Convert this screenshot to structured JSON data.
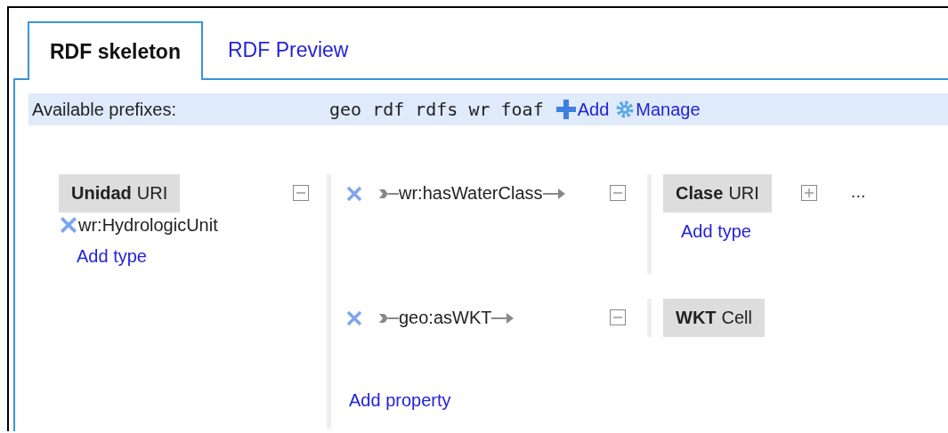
{
  "tabs": [
    {
      "label": "RDF skeleton",
      "selected": true
    },
    {
      "label": "RDF Preview",
      "selected": false
    }
  ],
  "prefix_bar": {
    "label": "Available prefixes:",
    "prefixes": [
      "geo",
      "rdf",
      "rdfs",
      "wr",
      "foaf"
    ],
    "add_label": "Add",
    "manage_label": "Manage"
  },
  "root_node": {
    "column": "Unidad",
    "node_type": "URI",
    "expanded": true,
    "types": [
      "wr:HydrologicUnit"
    ],
    "add_type": "Add type",
    "properties": [
      {
        "name": "wr:hasWaterClass",
        "expanded": true,
        "target": {
          "column": "Clase",
          "node_type": "URI",
          "expanded": false,
          "add_type": "Add type",
          "more": "..."
        }
      },
      {
        "name": "geo:asWKT",
        "expanded": true,
        "target": {
          "column": "WKT",
          "node_type": "Cell"
        }
      }
    ],
    "add_property": "Add property"
  }
}
